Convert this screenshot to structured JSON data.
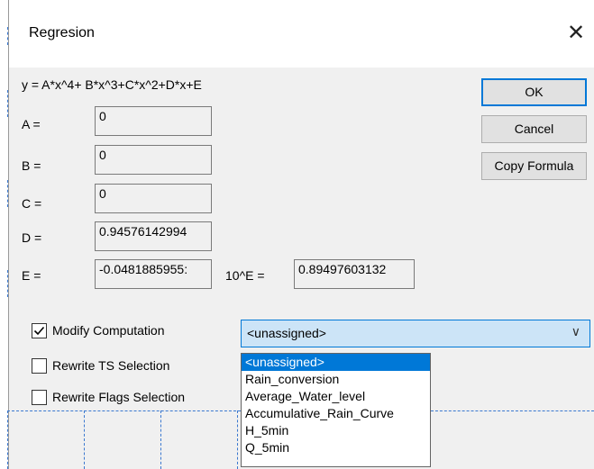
{
  "window": {
    "title": "Regresion",
    "close_icon": "close-icon"
  },
  "formula": "y =  A*x^4+ B*x^3+C*x^2+D*x+E",
  "coefficients": [
    {
      "label": "A =",
      "value": "0"
    },
    {
      "label": "B =",
      "value": "0"
    },
    {
      "label": "C =",
      "value": "0"
    },
    {
      "label": "D =",
      "value": "0.94576142994"
    },
    {
      "label": "E =",
      "value": "-0.0481885955:"
    }
  ],
  "ten_e": {
    "label": "10^E =",
    "value": "0.89497603132"
  },
  "buttons": {
    "ok": "OK",
    "cancel": "Cancel",
    "copy_formula": "Copy Formula"
  },
  "checkboxes": [
    {
      "label": "Modify Computation",
      "checked": true
    },
    {
      "label": "Rewrite TS Selection",
      "checked": false
    },
    {
      "label": "Rewrite Flags Selection",
      "checked": false
    }
  ],
  "computation_select": {
    "selected": "<unassigned>",
    "options": [
      "<unassigned>",
      "Rain_conversion",
      "Average_Water_level",
      "Accumulative_Rain_Curve",
      "H_5min",
      "Q_5min"
    ]
  },
  "colors": {
    "accent": "#0078d7",
    "combo_bg": "#cce4f7",
    "dialog_bg": "#f0f0f0"
  }
}
